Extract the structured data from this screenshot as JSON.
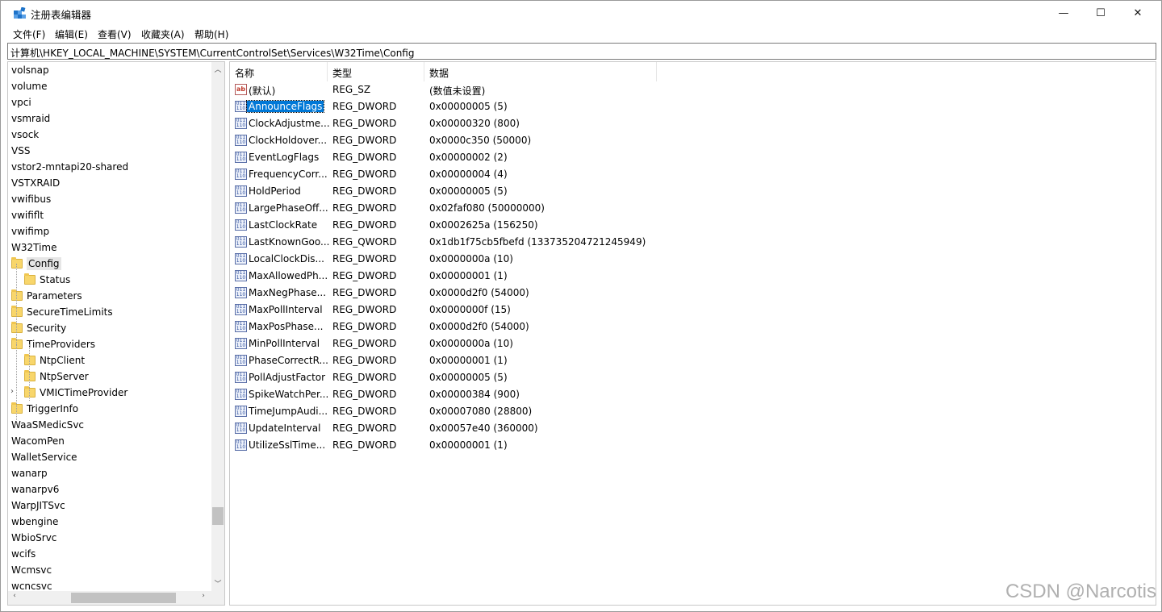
{
  "window": {
    "title": "注册表编辑器",
    "minimize": "—",
    "maximize": "☐",
    "close": "✕"
  },
  "menu": [
    "文件(F)",
    "编辑(E)",
    "查看(V)",
    "收藏夹(A)",
    "帮助(H)"
  ],
  "address": "计算机\\HKEY_LOCAL_MACHINE\\SYSTEM\\CurrentControlSet\\Services\\W32Time\\Config",
  "tree": [
    {
      "label": "volsnap",
      "level": 0,
      "folder": false
    },
    {
      "label": "volume",
      "level": 0,
      "folder": false
    },
    {
      "label": "vpci",
      "level": 0,
      "folder": false
    },
    {
      "label": "vsmraid",
      "level": 0,
      "folder": false
    },
    {
      "label": "vsock",
      "level": 0,
      "folder": false
    },
    {
      "label": "VSS",
      "level": 0,
      "folder": false
    },
    {
      "label": "vstor2-mntapi20-shared",
      "level": 0,
      "folder": false
    },
    {
      "label": "VSTXRAID",
      "level": 0,
      "folder": false
    },
    {
      "label": "vwifibus",
      "level": 0,
      "folder": false
    },
    {
      "label": "vwififlt",
      "level": 0,
      "folder": false
    },
    {
      "label": "vwifimp",
      "level": 0,
      "folder": false
    },
    {
      "label": "W32Time",
      "level": 0,
      "folder": false
    },
    {
      "label": "Config",
      "level": 1,
      "folder": true,
      "selected": true
    },
    {
      "label": "Status",
      "level": 2,
      "folder": true
    },
    {
      "label": "Parameters",
      "level": 1,
      "folder": true
    },
    {
      "label": "SecureTimeLimits",
      "level": 1,
      "folder": true
    },
    {
      "label": "Security",
      "level": 1,
      "folder": true
    },
    {
      "label": "TimeProviders",
      "level": 1,
      "folder": true
    },
    {
      "label": "NtpClient",
      "level": 2,
      "folder": true
    },
    {
      "label": "NtpServer",
      "level": 2,
      "folder": true
    },
    {
      "label": "VMICTimeProvider",
      "level": 2,
      "folder": true,
      "expander": "›"
    },
    {
      "label": "TriggerInfo",
      "level": 1,
      "folder": true
    },
    {
      "label": "WaaSMedicSvc",
      "level": 0,
      "folder": false
    },
    {
      "label": "WacomPen",
      "level": 0,
      "folder": false
    },
    {
      "label": "WalletService",
      "level": 0,
      "folder": false
    },
    {
      "label": "wanarp",
      "level": 0,
      "folder": false
    },
    {
      "label": "wanarpv6",
      "level": 0,
      "folder": false
    },
    {
      "label": "WarpJITSvc",
      "level": 0,
      "folder": false
    },
    {
      "label": "wbengine",
      "level": 0,
      "folder": false
    },
    {
      "label": "WbioSrvc",
      "level": 0,
      "folder": false
    },
    {
      "label": "wcifs",
      "level": 0,
      "folder": false
    },
    {
      "label": "Wcmsvc",
      "level": 0,
      "folder": false
    },
    {
      "label": "wcncsvc",
      "level": 0,
      "folder": false
    }
  ],
  "columns": {
    "name": "名称",
    "type": "类型",
    "data": "数据"
  },
  "values": [
    {
      "name": "(默认)",
      "type": "REG_SZ",
      "data": "(数值未设置)",
      "icon": "string-value-icon",
      "glyph": "ab"
    },
    {
      "name": "AnnounceFlags",
      "type": "REG_DWORD",
      "data": "0x00000005 (5)",
      "icon": "binary-value-icon",
      "glyph": "011\n110",
      "selected": true
    },
    {
      "name": "ClockAdjustme...",
      "type": "REG_DWORD",
      "data": "0x00000320 (800)",
      "icon": "binary-value-icon",
      "glyph": "011\n110"
    },
    {
      "name": "ClockHoldover...",
      "type": "REG_DWORD",
      "data": "0x0000c350 (50000)",
      "icon": "binary-value-icon",
      "glyph": "011\n110"
    },
    {
      "name": "EventLogFlags",
      "type": "REG_DWORD",
      "data": "0x00000002 (2)",
      "icon": "binary-value-icon",
      "glyph": "011\n110"
    },
    {
      "name": "FrequencyCorr...",
      "type": "REG_DWORD",
      "data": "0x00000004 (4)",
      "icon": "binary-value-icon",
      "glyph": "011\n110"
    },
    {
      "name": "HoldPeriod",
      "type": "REG_DWORD",
      "data": "0x00000005 (5)",
      "icon": "binary-value-icon",
      "glyph": "011\n110"
    },
    {
      "name": "LargePhaseOff...",
      "type": "REG_DWORD",
      "data": "0x02faf080 (50000000)",
      "icon": "binary-value-icon",
      "glyph": "011\n110"
    },
    {
      "name": "LastClockRate",
      "type": "REG_DWORD",
      "data": "0x0002625a (156250)",
      "icon": "binary-value-icon",
      "glyph": "011\n110"
    },
    {
      "name": "LastKnownGoo...",
      "type": "REG_QWORD",
      "data": "0x1db1f75cb5fbefd (133735204721245949)",
      "icon": "binary-value-icon",
      "glyph": "011\n110"
    },
    {
      "name": "LocalClockDis...",
      "type": "REG_DWORD",
      "data": "0x0000000a (10)",
      "icon": "binary-value-icon",
      "glyph": "011\n110"
    },
    {
      "name": "MaxAllowedPh...",
      "type": "REG_DWORD",
      "data": "0x00000001 (1)",
      "icon": "binary-value-icon",
      "glyph": "011\n110"
    },
    {
      "name": "MaxNegPhase...",
      "type": "REG_DWORD",
      "data": "0x0000d2f0 (54000)",
      "icon": "binary-value-icon",
      "glyph": "011\n110"
    },
    {
      "name": "MaxPollInterval",
      "type": "REG_DWORD",
      "data": "0x0000000f (15)",
      "icon": "binary-value-icon",
      "glyph": "011\n110"
    },
    {
      "name": "MaxPosPhase...",
      "type": "REG_DWORD",
      "data": "0x0000d2f0 (54000)",
      "icon": "binary-value-icon",
      "glyph": "011\n110"
    },
    {
      "name": "MinPollInterval",
      "type": "REG_DWORD",
      "data": "0x0000000a (10)",
      "icon": "binary-value-icon",
      "glyph": "011\n110"
    },
    {
      "name": "PhaseCorrectR...",
      "type": "REG_DWORD",
      "data": "0x00000001 (1)",
      "icon": "binary-value-icon",
      "glyph": "011\n110"
    },
    {
      "name": "PollAdjustFactor",
      "type": "REG_DWORD",
      "data": "0x00000005 (5)",
      "icon": "binary-value-icon",
      "glyph": "011\n110"
    },
    {
      "name": "SpikeWatchPer...",
      "type": "REG_DWORD",
      "data": "0x00000384 (900)",
      "icon": "binary-value-icon",
      "glyph": "011\n110"
    },
    {
      "name": "TimeJumpAudi...",
      "type": "REG_DWORD",
      "data": "0x00007080 (28800)",
      "icon": "binary-value-icon",
      "glyph": "011\n110"
    },
    {
      "name": "UpdateInterval",
      "type": "REG_DWORD",
      "data": "0x00057e40 (360000)",
      "icon": "binary-value-icon",
      "glyph": "011\n110"
    },
    {
      "name": "UtilizeSslTime...",
      "type": "REG_DWORD",
      "data": "0x00000001 (1)",
      "icon": "binary-value-icon",
      "glyph": "011\n110"
    }
  ],
  "scroll": {
    "up": "︿",
    "down": "﹀",
    "left": "‹",
    "right": "›"
  },
  "watermark": "CSDN @Narcotis"
}
